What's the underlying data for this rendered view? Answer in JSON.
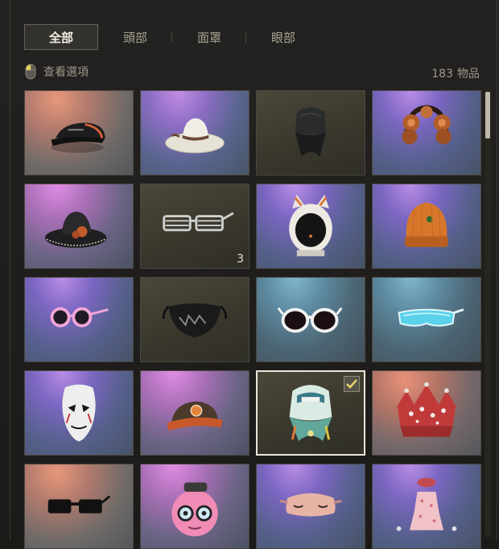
{
  "tabs": [
    {
      "label": "全部",
      "active": true
    },
    {
      "label": "頭部",
      "active": false
    },
    {
      "label": "面罩",
      "active": false
    },
    {
      "label": "眼部",
      "active": false
    }
  ],
  "subbar": {
    "view_options_label": "查看選項",
    "count_value": "183",
    "count_unit": "物品"
  },
  "items": [
    {
      "icon": "black-cap-icon",
      "bg": "orange"
    },
    {
      "icon": "white-cowboy-hat-icon",
      "bg": "purple"
    },
    {
      "icon": "black-bandana-icon",
      "bg": "dark"
    },
    {
      "icon": "floral-headband-icon",
      "bg": "violet"
    },
    {
      "icon": "black-cowboy-hat-icon",
      "bg": "pink"
    },
    {
      "icon": "shutter-shades-icon",
      "bg": "dark",
      "qty": "3"
    },
    {
      "icon": "cat-helmet-icon",
      "bg": "violet"
    },
    {
      "icon": "orange-beanie-icon",
      "bg": "violet"
    },
    {
      "icon": "pink-round-glasses-icon",
      "bg": "violet"
    },
    {
      "icon": "black-face-mask-icon",
      "bg": "dark"
    },
    {
      "icon": "white-sunglasses-icon",
      "bg": "teal"
    },
    {
      "icon": "blue-visor-glasses-icon",
      "bg": "teal"
    },
    {
      "icon": "white-mask-icon",
      "bg": "violet"
    },
    {
      "icon": "orange-cap-icon",
      "bg": "pink"
    },
    {
      "icon": "headscarf-icon",
      "bg": "dark",
      "selected": true
    },
    {
      "icon": "red-crown-icon",
      "bg": "red"
    },
    {
      "icon": "black-sunglasses-icon",
      "bg": "orange"
    },
    {
      "icon": "pink-donut-head-icon",
      "bg": "pink"
    },
    {
      "icon": "sleep-mask-icon",
      "bg": "violet"
    },
    {
      "icon": "pink-dress-icon",
      "bg": "violet"
    }
  ],
  "colors": {
    "accent": "#e9e6da",
    "panel": "#1b1a17",
    "check": "#e8d36a"
  }
}
